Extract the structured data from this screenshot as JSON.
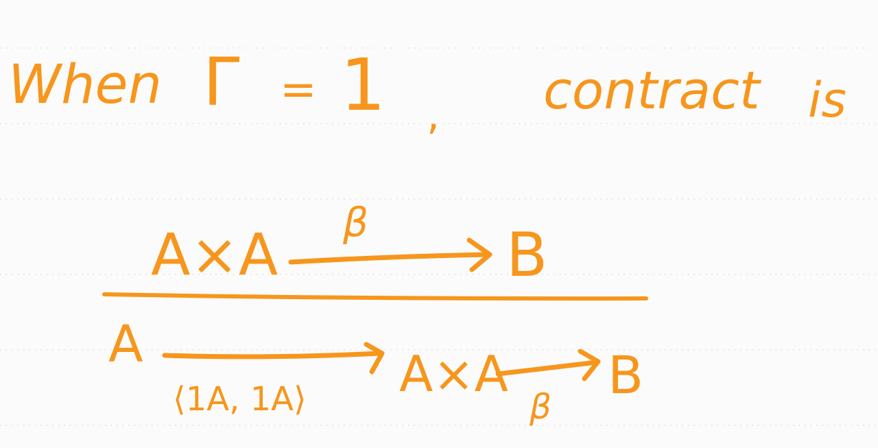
{
  "ink_color": "#f7961c",
  "rule_color": "#d9d9d9",
  "page_bg": "#fbfbfb",
  "heading": {
    "when": "When",
    "gamma": "Γ",
    "equals": "=",
    "one": "1",
    "comma": ",",
    "contract": "contract",
    "is": "is"
  },
  "premise": {
    "source": "A×A",
    "label": "β",
    "target": "B"
  },
  "conclusion": {
    "source": "A",
    "pair_label": "⟨1A, 1A⟩",
    "middle": "A×A",
    "label": "β",
    "target": "B"
  }
}
